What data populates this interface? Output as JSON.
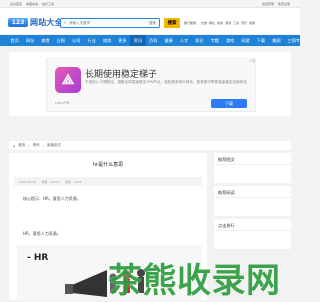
{
  "topbar": {
    "left": [
      "设为首页",
      "收藏本站",
      "站长工具"
    ],
    "right": [
      "会员登录",
      "免费注册",
      "注册"
    ]
  },
  "logo": {
    "badge": "123",
    "name": "网站大全"
  },
  "search": {
    "placeholder": "请输入关键词",
    "select": "搜索",
    "button": "搜索"
  },
  "hotwords": {
    "label": "热门搜索：",
    "items": [
      "文章",
      "网址",
      "新闻",
      "游戏",
      "工具",
      "音乐",
      "视频"
    ]
  },
  "nav": {
    "items": [
      "首页",
      "网址",
      "美食",
      "日报",
      "公司",
      "行业",
      "旅游",
      "更多",
      "资讯",
      "百科",
      "健康",
      "人才",
      "知识",
      "专题",
      "游戏",
      "网游",
      "下载",
      "美图",
      "三国专题"
    ],
    "active_index": 8
  },
  "ad": {
    "title": "长期使用稳定梯子",
    "desc": "不用担心卡顿断连，搜集全球高速稳定VPN节点，轻松畅游海外网站，登录即可享受高速稳定加速体验",
    "brand": "LetsVPN",
    "button": "下载",
    "mark": "广告"
  },
  "breadcrumb": [
    "首页",
    "资讯",
    "阅读全文"
  ],
  "article": {
    "title": "hr是什么意思",
    "meta": [
      "2024-06-01",
      "作者：admin",
      "阅读：1024"
    ],
    "p1": "核心提示：HR，意思人力资源。",
    "p2": "HR，意思人力资源。",
    "image_text": "- HR"
  },
  "sidebar": {
    "boxes": [
      "推荐图文",
      "推荐阅读",
      "点击排行"
    ]
  },
  "watermark": "茶熊收录网"
}
